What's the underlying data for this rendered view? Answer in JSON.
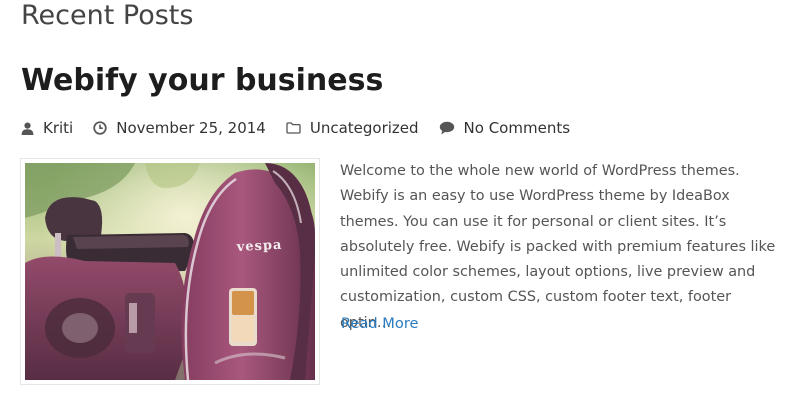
{
  "section": {
    "title": "Recent Posts"
  },
  "post": {
    "title": "Webify your business",
    "meta": {
      "author": "Kriti",
      "author_icon": "user-icon",
      "date": "November 25, 2014",
      "date_icon": "clock-icon",
      "category": "Uncategorized",
      "category_icon": "folder-icon",
      "comments": "No Comments",
      "comments_icon": "comment-icon"
    },
    "thumbnail": {
      "badge_text": "vespa"
    },
    "excerpt": "Welcome to the whole new world of WordPress themes. Webify is an easy to use WordPress theme by IdeaBox themes. You can use it for personal or client sites. It’s absolutely free. Webify is packed with premium features like unlimited color schemes, layout options, live preview and customization, custom CSS, custom footer text, footer optin…",
    "read_more": "Read More"
  },
  "colors": {
    "heading": "#444444",
    "post_title": "#1d1d1d",
    "link": "#2a7cbf",
    "body_text": "#555555"
  }
}
